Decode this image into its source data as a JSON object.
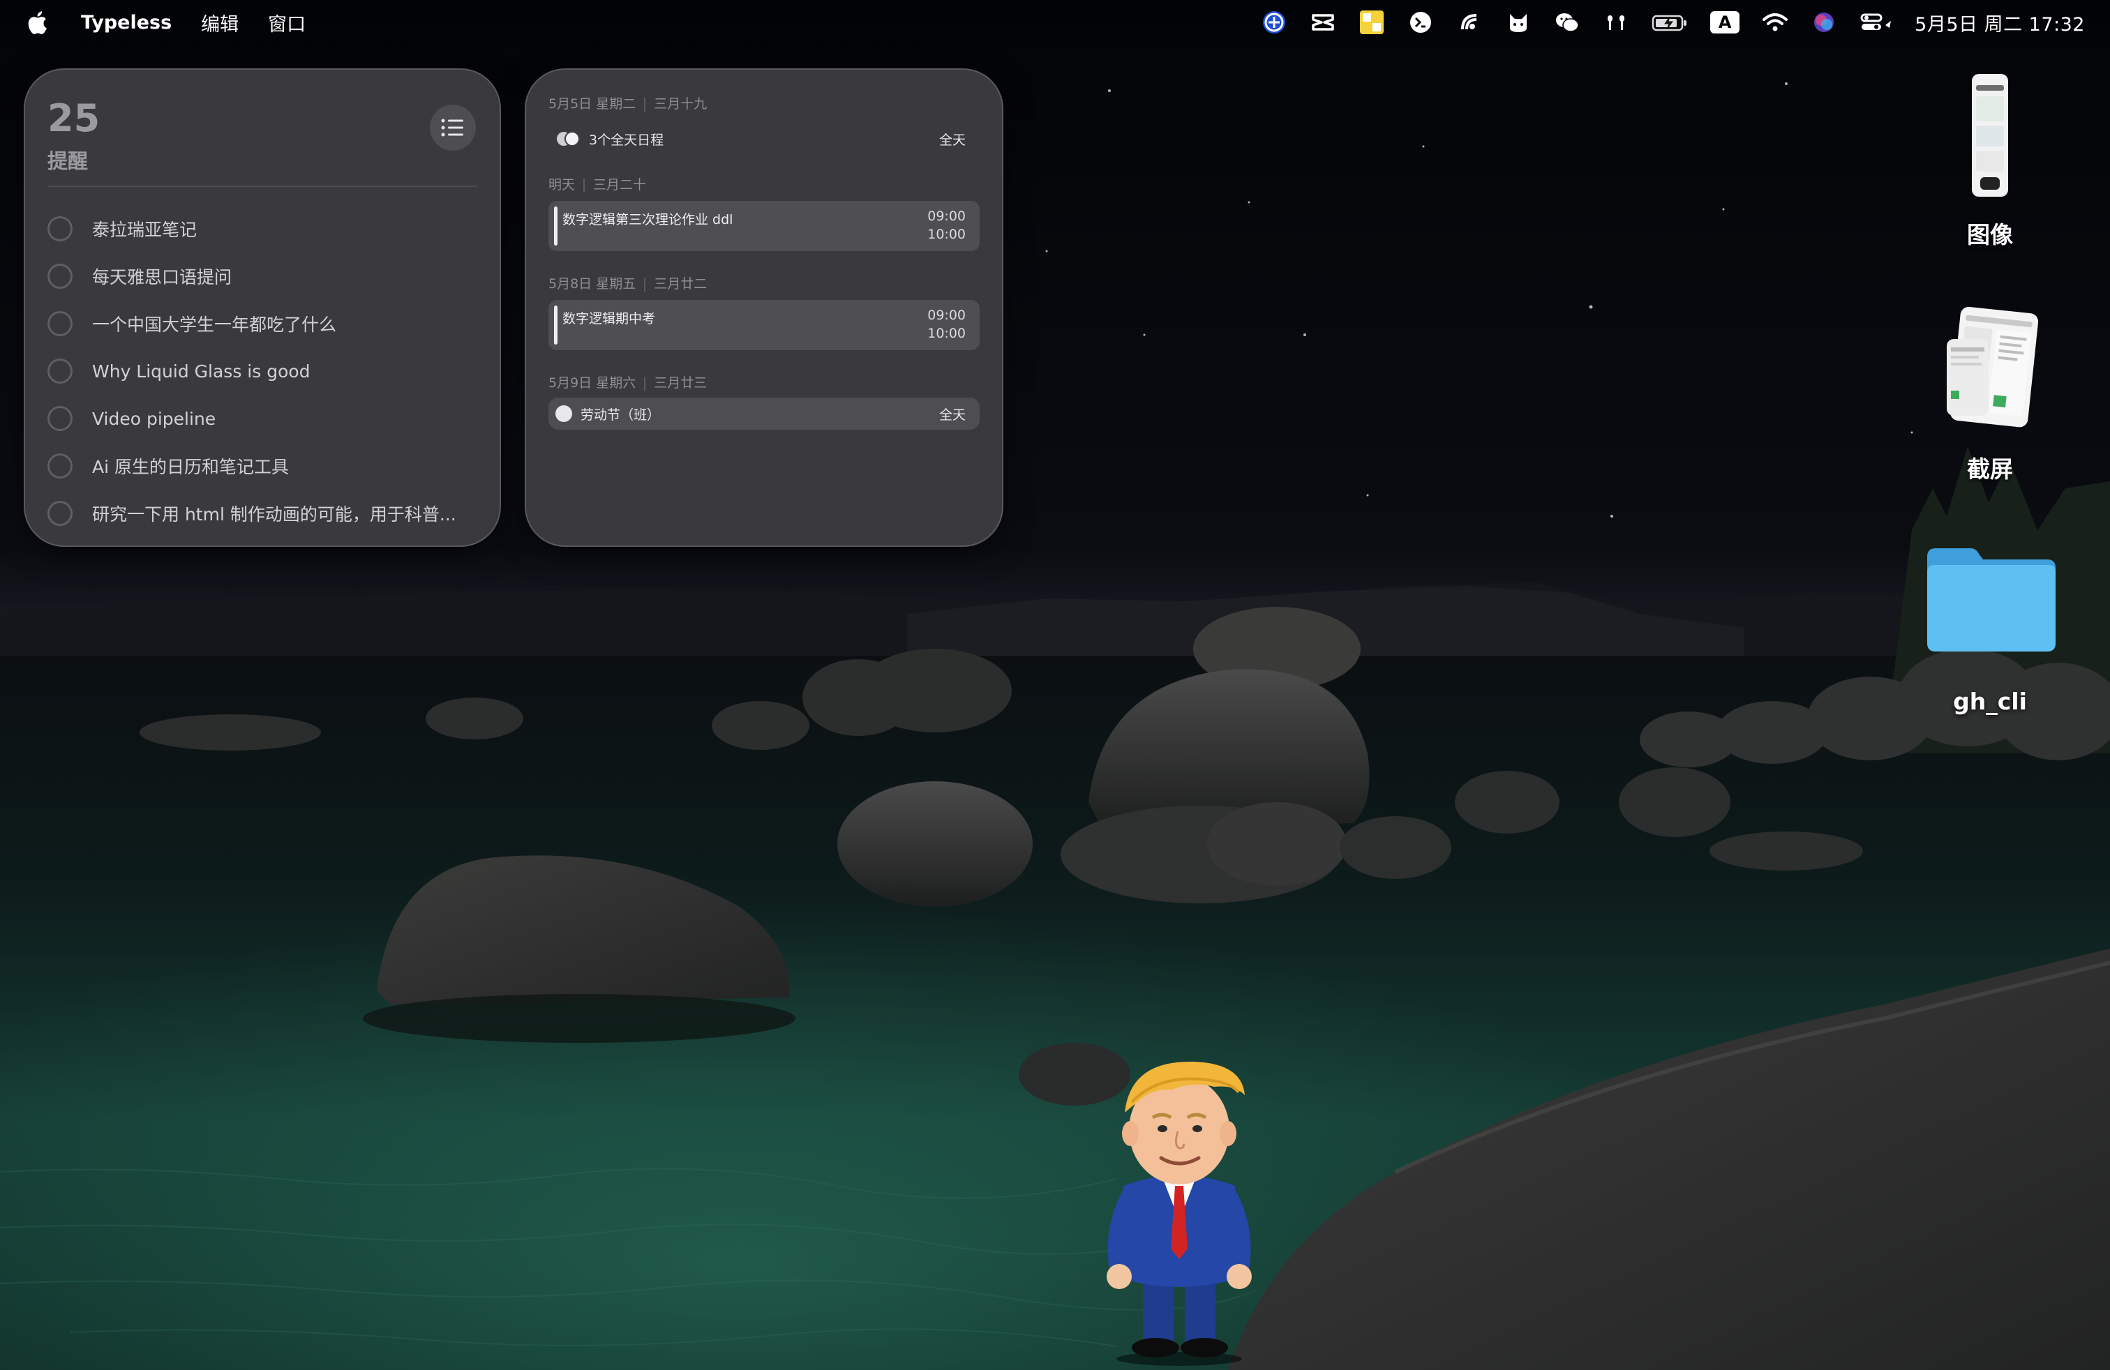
{
  "menu_bar": {
    "apple_icon": "apple-logo-icon",
    "app_name": "Typeless",
    "menus": [
      "编辑",
      "窗口"
    ],
    "status_icons": [
      "browser-icon",
      "capcut-icon",
      "notes-app-icon",
      "terminal-icon",
      "airdrop-icon",
      "cat-icon",
      "wechat-icon",
      "airpods-icon",
      "battery-charging-icon",
      "input-method-icon",
      "wifi-icon",
      "siri-icon",
      "control-center-icon"
    ],
    "input_method_label": "A",
    "clock": "5月5日 周二 17:32"
  },
  "reminders": {
    "count": "25",
    "title": "提醒",
    "items": [
      "泰拉瑞亚笔记",
      "每天雅思口语提问",
      "一个中国大学生一年都吃了什么",
      "Why Liquid Glass is good",
      "Video pipeline",
      "Ai 原生的日历和笔记工具",
      "研究一下用 html 制作动画的可能，用于科普..."
    ]
  },
  "calendar": {
    "today": {
      "date": "5月5日 星期二",
      "lunar": "三月十九",
      "allday_label": "3个全天日程",
      "allday_right": "全天"
    },
    "tomorrow": {
      "date": "明天",
      "lunar": "三月二十",
      "event": {
        "title": "数字逻辑第三次理论作业 ddl",
        "start": "09:00",
        "end": "10:00"
      }
    },
    "day3": {
      "date": "5月8日 星期五",
      "lunar": "三月廿二",
      "event": {
        "title": "数字逻辑期中考",
        "start": "09:00",
        "end": "10:00"
      }
    },
    "day4": {
      "date": "5月9日 星期六",
      "lunar": "三月廿三",
      "allday_label": "劳动节（班）",
      "allday_right": "全天"
    }
  },
  "desktop": {
    "items": [
      {
        "label": "图像",
        "kind": "image-file"
      },
      {
        "label": "截屏",
        "kind": "screenshot-file"
      },
      {
        "label": "gh_cli",
        "kind": "folder"
      }
    ]
  },
  "colors": {
    "widget_bg": "#3e3e42",
    "folder_blue": "#58b9ee",
    "water_green": "#1f5a4c"
  }
}
